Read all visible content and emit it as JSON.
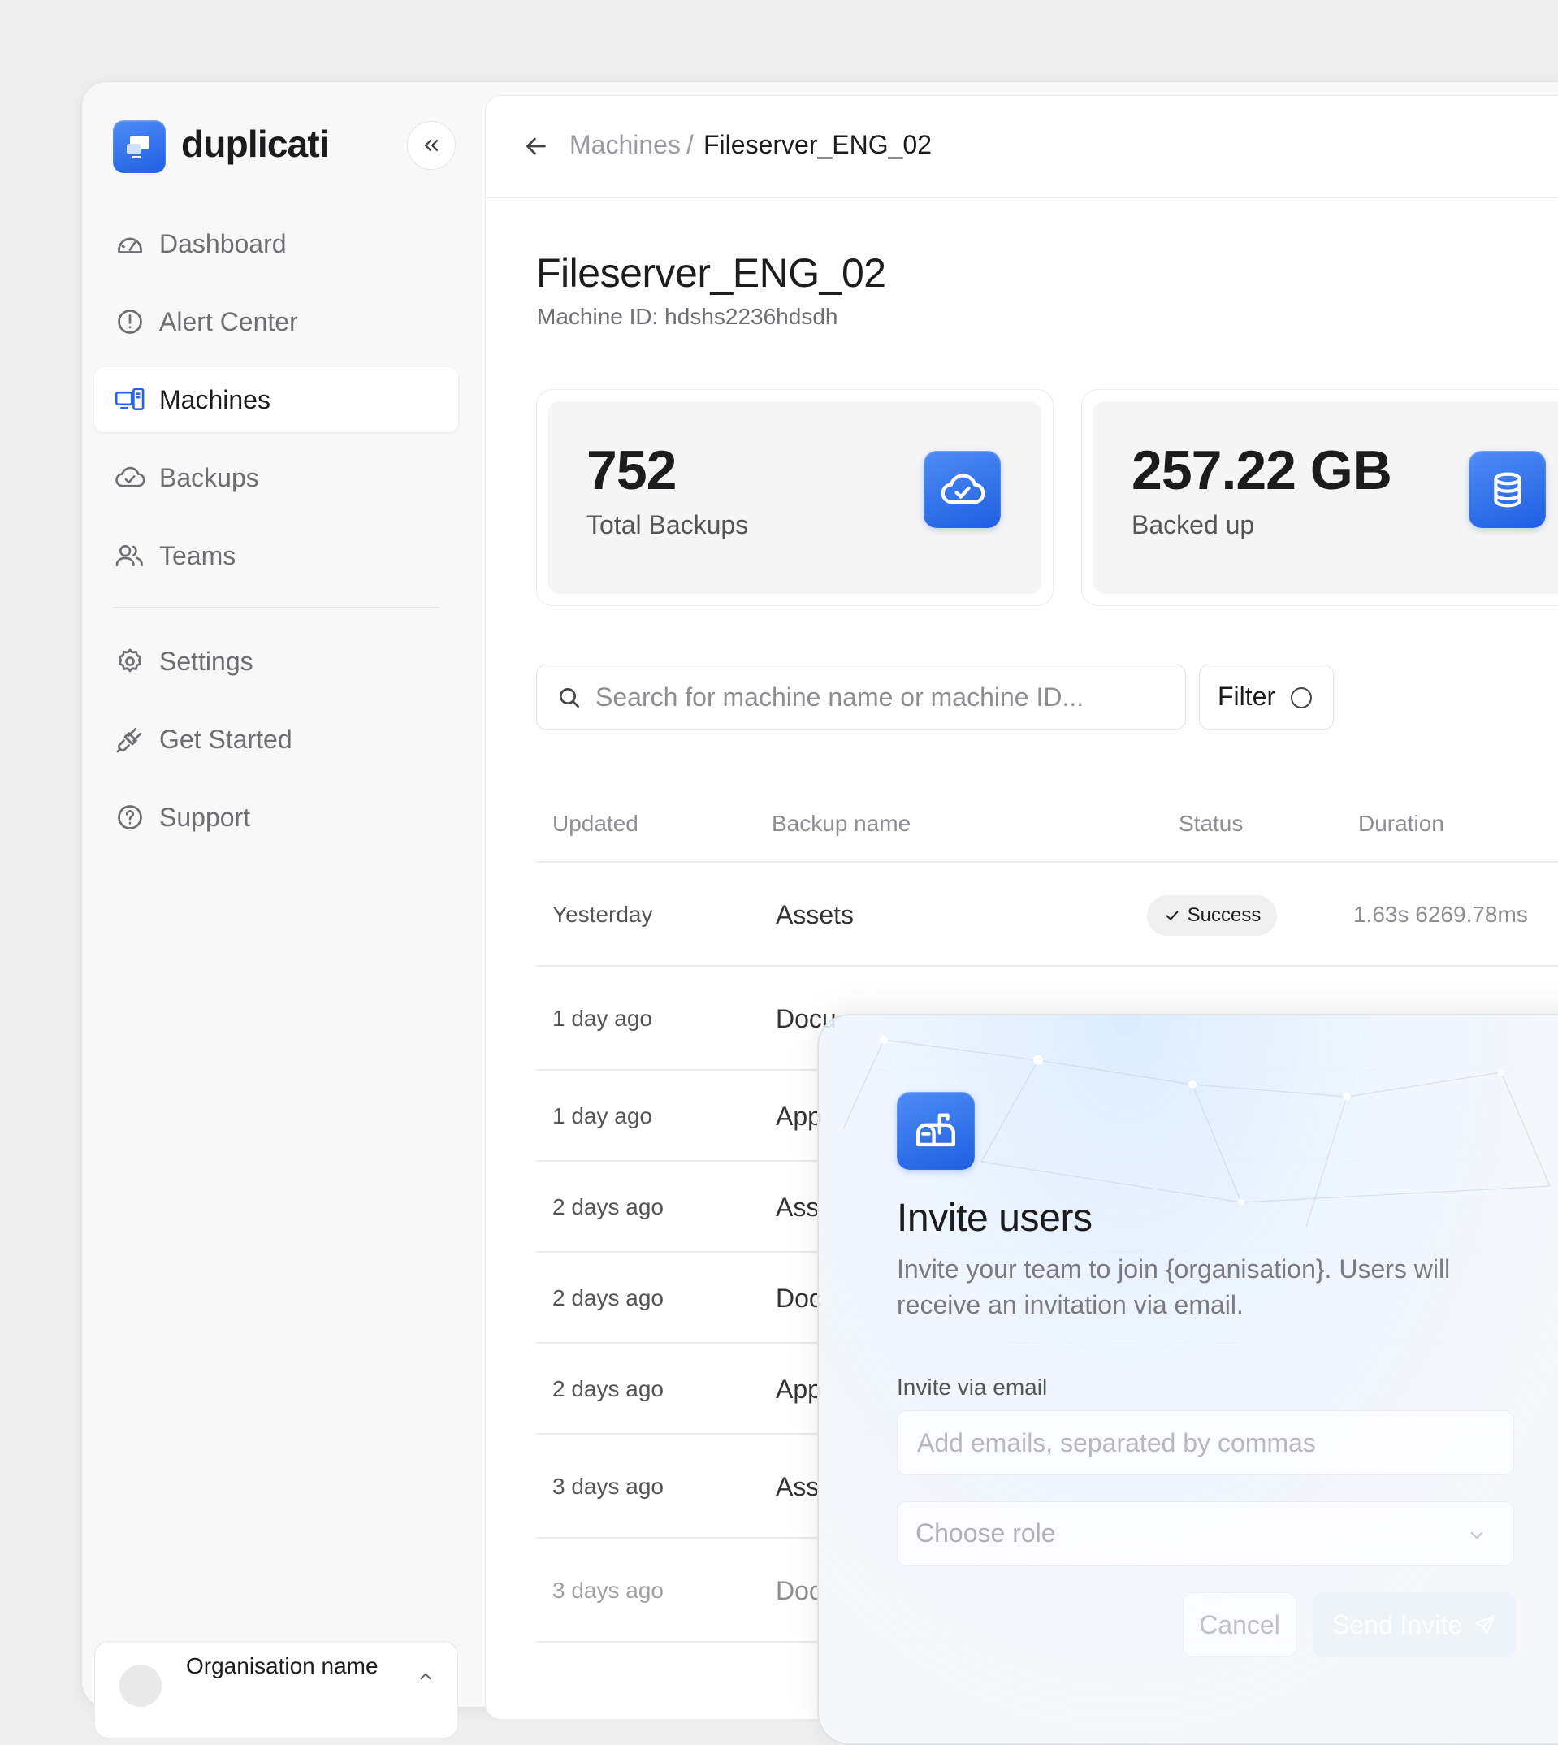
{
  "app": {
    "name": "duplicati"
  },
  "sidebar": {
    "items": [
      {
        "label": "Dashboard",
        "icon": "gauge-icon"
      },
      {
        "label": "Alert Center",
        "icon": "alert-circle-icon"
      },
      {
        "label": "Machines",
        "icon": "machines-icon",
        "active": true
      },
      {
        "label": "Backups",
        "icon": "cloud-check-icon"
      },
      {
        "label": "Teams",
        "icon": "users-icon"
      },
      {
        "label": "Settings",
        "icon": "gear-icon"
      },
      {
        "label": "Get Started",
        "icon": "plug-icon"
      },
      {
        "label": "Support",
        "icon": "help-circle-icon"
      }
    ],
    "organisation": {
      "name": "Organisation name"
    }
  },
  "breadcrumb": {
    "parent": "Machines",
    "separator": "/",
    "current": "Fileserver_ENG_02"
  },
  "machine": {
    "title": "Fileserver_ENG_02",
    "id_line": "Machine ID: hdshs2236hdsdh"
  },
  "stats": [
    {
      "value": "752",
      "label": "Total Backups",
      "icon": "cloud-check-icon"
    },
    {
      "value": "257.22 GB",
      "label": "Backed up",
      "icon": "database-icon"
    }
  ],
  "search": {
    "placeholder": "Search for machine name or machine ID..."
  },
  "filter": {
    "label": "Filter"
  },
  "table": {
    "headers": {
      "updated": "Updated",
      "name": "Backup name",
      "status": "Status",
      "duration": "Duration"
    },
    "rows": [
      {
        "updated": "Yesterday",
        "name": "Assets",
        "status": "Success",
        "duration": "1.63s 6269.78ms"
      },
      {
        "updated": "1 day ago",
        "name": "Docu"
      },
      {
        "updated": "1 day ago",
        "name": "App"
      },
      {
        "updated": "2 days ago",
        "name": "Ass"
      },
      {
        "updated": "2 days ago",
        "name": "Doc"
      },
      {
        "updated": "2 days ago",
        "name": "App"
      },
      {
        "updated": "3 days ago",
        "name": "Ass"
      },
      {
        "updated": "3 days ago",
        "name": "Doc"
      }
    ]
  },
  "modal": {
    "title": "Invite users",
    "description": "Invite your team to join {organisation}. Users will receive an invitation via email.",
    "email_label": "Invite via email",
    "email_placeholder": "Add emails, separated by commas",
    "role_placeholder": "Choose role",
    "cancel_label": "Cancel",
    "send_label": "Send Invite"
  },
  "colors": {
    "accent": "#2563eb",
    "success_badge": "#f0f0f0"
  }
}
